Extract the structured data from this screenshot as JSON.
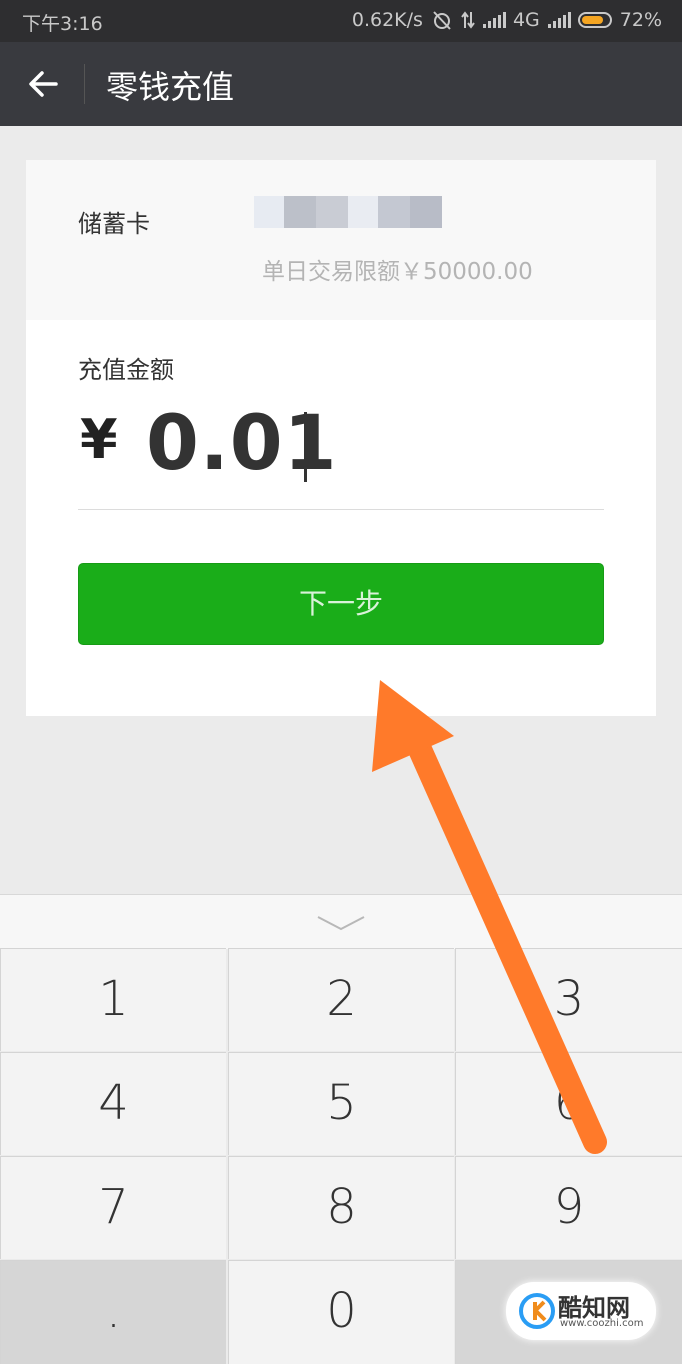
{
  "status_bar": {
    "time": "下午3:16",
    "network_speed": "0.62K/s",
    "network_type": "4G",
    "battery": "72%"
  },
  "nav": {
    "title": "零钱充值"
  },
  "payment": {
    "bank_label": "储蓄卡",
    "limit_text": "单日交易限额￥50000.00",
    "amount_label": "充值金额",
    "currency_symbol": "¥",
    "amount_value": "0.01",
    "next_button": "下一步"
  },
  "keypad": {
    "keys": [
      "1",
      "2",
      "3",
      "4",
      "5",
      "6",
      "7",
      "8",
      "9",
      ".",
      "0",
      ""
    ]
  },
  "watermark": {
    "name": "酷知网",
    "url": "www.coozhi.com"
  },
  "colors": {
    "status_bg": "#2e2e30",
    "nav_bg": "#393a3f",
    "page_bg": "#ebebeb",
    "button_green": "#1aad19",
    "arrow_orange": "#ff7a2a",
    "battery_fill": "#f5a623"
  }
}
